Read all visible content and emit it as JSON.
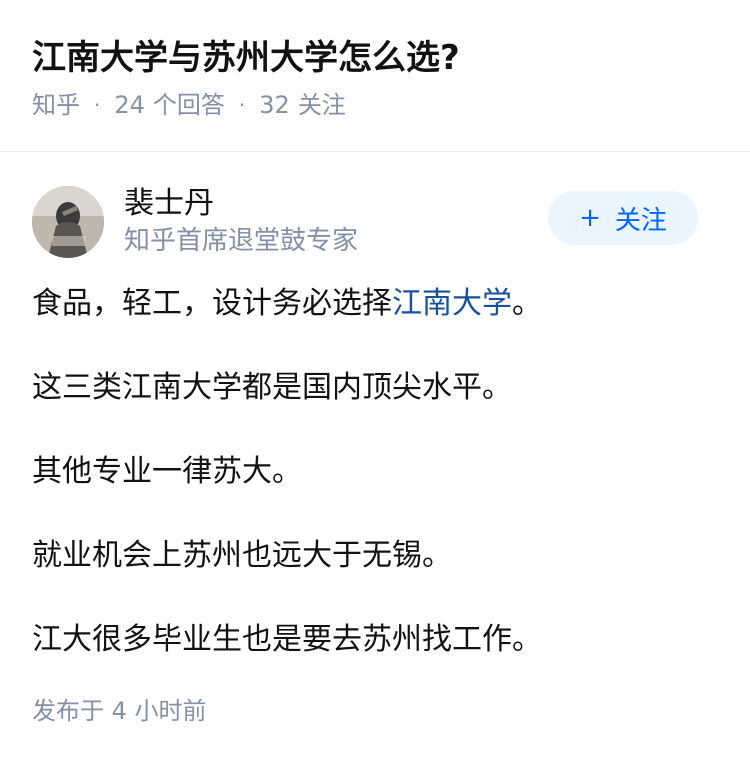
{
  "question": {
    "title": "江南大学与苏州大学怎么选?",
    "source": "知乎",
    "answers_count": "24",
    "answers_label": "个回答",
    "followers_count": "32",
    "followers_label": "关注"
  },
  "answer": {
    "author": {
      "name": "裴士丹",
      "headline": "知乎首席退堂鼓专家",
      "avatar": "avatar-photo"
    },
    "follow_button": {
      "icon": "+",
      "label": "关注"
    },
    "paragraphs": [
      {
        "before": "食品，轻工，设计务必选择",
        "link": "江南大学",
        "after": "。"
      },
      {
        "text": "这三类江南大学都是国内顶尖水平。"
      },
      {
        "text": "其他专业一律苏大。"
      },
      {
        "text": "就业机会上苏州也远大于无锡。"
      },
      {
        "text": "江大很多毕业生也是要去苏州找工作。"
      }
    ],
    "publish_label": "发布于",
    "publish_time": "4 小时前"
  },
  "colors": {
    "link": "#175199",
    "meta": "#8590a6",
    "accent": "#0066ff",
    "button_bg": "#ebf5ff"
  }
}
